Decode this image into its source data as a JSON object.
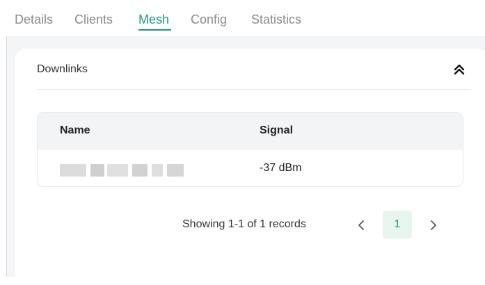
{
  "tabs": [
    {
      "label": "Details",
      "active": false
    },
    {
      "label": "Clients",
      "active": false
    },
    {
      "label": "Mesh",
      "active": true
    },
    {
      "label": "Config",
      "active": false
    },
    {
      "label": "Statistics",
      "active": false
    }
  ],
  "section": {
    "title": "Downlinks",
    "collapse_icon": "double-chevron-up-icon"
  },
  "table": {
    "columns": [
      "Name",
      "Signal"
    ],
    "rows": [
      {
        "name": "",
        "signal": "-37 dBm"
      }
    ]
  },
  "pagination": {
    "summary": "Showing 1-1 of 1 records",
    "prev_icon": "chevron-left-icon",
    "current_page": "1",
    "next_icon": "chevron-right-icon"
  },
  "colors": {
    "accent": "#1a9e6e",
    "page_active_bg": "#e6f5ee",
    "header_bg": "#f3f4f5"
  }
}
